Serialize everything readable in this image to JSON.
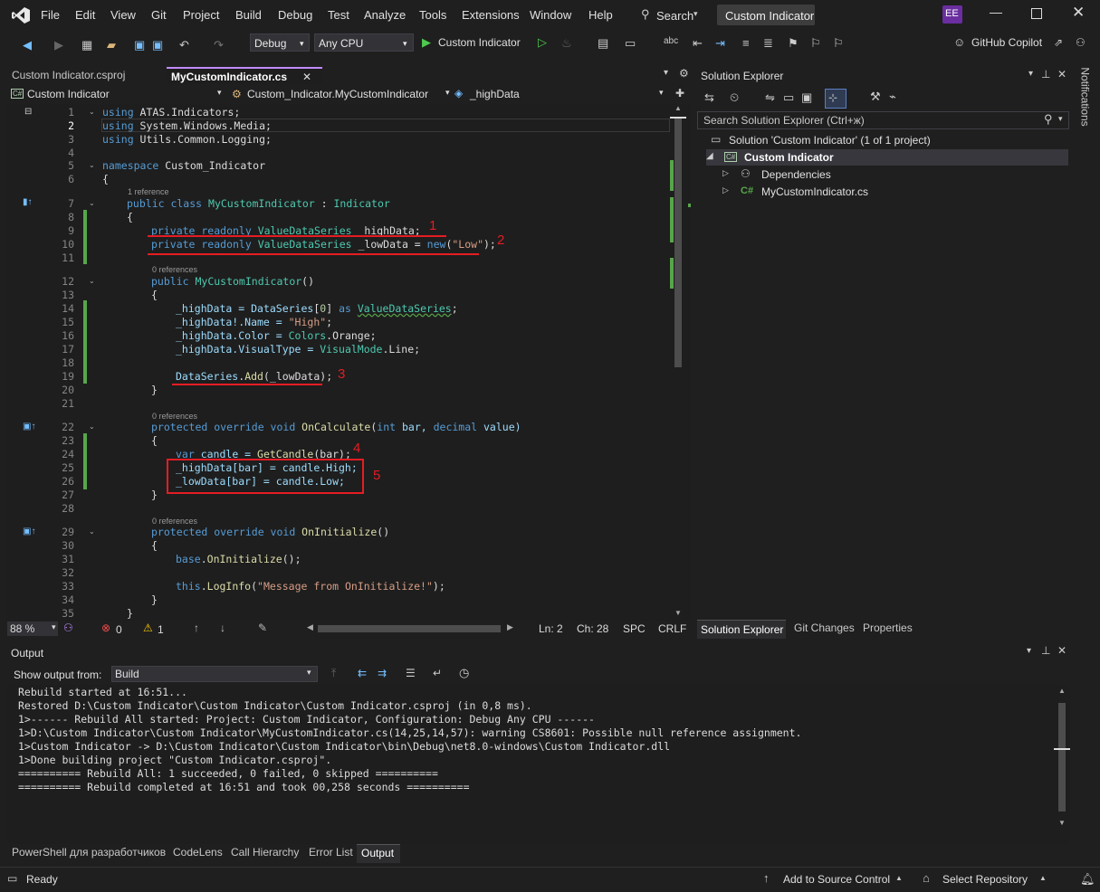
{
  "menu": [
    "File",
    "Edit",
    "View",
    "Git",
    "Project",
    "Build",
    "Debug",
    "Test",
    "Analyze",
    "Tools",
    "Extensions",
    "Window",
    "Help"
  ],
  "search_label": "Search",
  "title_chip": "Custom Indicator",
  "avatar": "EE",
  "toolbar": {
    "config": "Debug",
    "platform": "Any CPU",
    "run_label": "Custom Indicator",
    "copilot": "GitHub Copilot"
  },
  "tabs": {
    "inactive": "Custom Indicator.csproj",
    "active": "MyCustomIndicator.cs"
  },
  "nav": {
    "project": "Custom Indicator",
    "class": "Custom_Indicator.MyCustomIndicator",
    "member": "_highData"
  },
  "code": {
    "line_numbers": [
      "1",
      "2",
      "3",
      "4",
      "5",
      "6",
      "7",
      "8",
      "9",
      "10",
      "11",
      "12",
      "13",
      "14",
      "15",
      "16",
      "17",
      "18",
      "19",
      "20",
      "21",
      "22",
      "23",
      "24",
      "25",
      "26",
      "27",
      "28",
      "29",
      "30",
      "31",
      "32",
      "33",
      "34",
      "35"
    ],
    "hints": {
      "h1": "1 reference",
      "h2": "0 references",
      "h3": "0 references",
      "h4": "0 references"
    },
    "lines": {
      "l1": [
        "using",
        " ATAS.Indicators;"
      ],
      "l2": [
        "using",
        " System.Windows.Media;"
      ],
      "l3": [
        "using",
        " Utils.Common.Logging;"
      ],
      "l5": [
        "namespace",
        " Custom_Indicator"
      ],
      "l6": "{",
      "l7": [
        "public class ",
        "MyCustomIndicator",
        " : ",
        "Indicator"
      ],
      "l8": "{",
      "l9": [
        "private readonly ",
        "ValueDataSeries",
        " _highData;"
      ],
      "l10": [
        "private readonly ",
        "ValueDataSeries",
        " _lowData = ",
        "new",
        "(",
        "\"Low\"",
        ");"
      ],
      "l12": [
        "public ",
        "MyCustomIndicator",
        "()"
      ],
      "l13": "{",
      "l14": [
        "_highData = ",
        "DataSeries",
        "[",
        "0",
        "] ",
        "as ",
        "ValueDataSeries",
        ";"
      ],
      "l15": [
        "_highData!.Name = ",
        "\"High\"",
        ";"
      ],
      "l16": [
        "_highData.Color = ",
        "Colors",
        ".Orange;"
      ],
      "l17": [
        "_highData.VisualType = ",
        "VisualMode",
        ".Line;"
      ],
      "l19": [
        "DataSeries",
        ".",
        "Add",
        "(_lowData);"
      ],
      "l20": "}",
      "l22": [
        "protected override void ",
        "OnCalculate",
        "(",
        "int",
        " bar, ",
        "decimal",
        " value)"
      ],
      "l23": "{",
      "l24": [
        "var",
        " candle = ",
        "GetCandle",
        "(bar);"
      ],
      "l25": [
        "_highData[bar] = candle.High;"
      ],
      "l26": [
        "_lowData[bar] = candle.Low;"
      ],
      "l27": "}",
      "l29": [
        "protected override void ",
        "OnInitialize",
        "()"
      ],
      "l30": "{",
      "l31": [
        "base",
        ".",
        "OnInitialize",
        "();"
      ],
      "l33": [
        "this",
        ".",
        "LogInfo",
        "(",
        "\"Message from OnInitialize!\"",
        ");"
      ],
      "l34": "}",
      "l35": "}"
    },
    "annotations": [
      "1",
      "2",
      "3",
      "4",
      "5"
    ]
  },
  "editor_status": {
    "zoom": "88 %",
    "errors": "0",
    "warnings": "1",
    "ln": "Ln: 2",
    "ch": "Ch: 28",
    "spc": "SPC",
    "crlf": "CRLF"
  },
  "solution": {
    "title": "Solution Explorer",
    "search_placeholder": "Search Solution Explorer (Ctrl+ж)",
    "solution_item": "Solution 'Custom Indicator' (1 of 1 project)",
    "project_item": "Custom Indicator",
    "deps": "Dependencies",
    "file": "MyCustomIndicator.cs",
    "tabs": [
      "Solution Explorer",
      "Git Changes",
      "Properties"
    ]
  },
  "notifications": "Notifications",
  "output": {
    "title": "Output",
    "show_from_label": "Show output from:",
    "source": "Build",
    "lines": [
      "Rebuild started at 16:51...",
      "Restored D:\\Custom Indicator\\Custom Indicator\\Custom Indicator.csproj (in 0,8 ms).",
      "1>------ Rebuild All started: Project: Custom Indicator, Configuration: Debug Any CPU ------",
      "1>D:\\Custom Indicator\\Custom Indicator\\MyCustomIndicator.cs(14,25,14,57): warning CS8601: Possible null reference assignment.",
      "1>Custom Indicator -> D:\\Custom Indicator\\Custom Indicator\\bin\\Debug\\net8.0-windows\\Custom Indicator.dll",
      "1>Done building project \"Custom Indicator.csproj\".",
      "========== Rebuild All: 1 succeeded, 0 failed, 0 skipped ==========",
      "========== Rebuild completed at 16:51 and took 00,258 seconds =========="
    ]
  },
  "bottom_tabs": [
    "PowerShell для разработчиков",
    "CodeLens",
    "Call Hierarchy",
    "Error List",
    "Output"
  ],
  "status": {
    "ready": "Ready",
    "source_control": "Add to Source Control",
    "repo": "Select Repository"
  }
}
